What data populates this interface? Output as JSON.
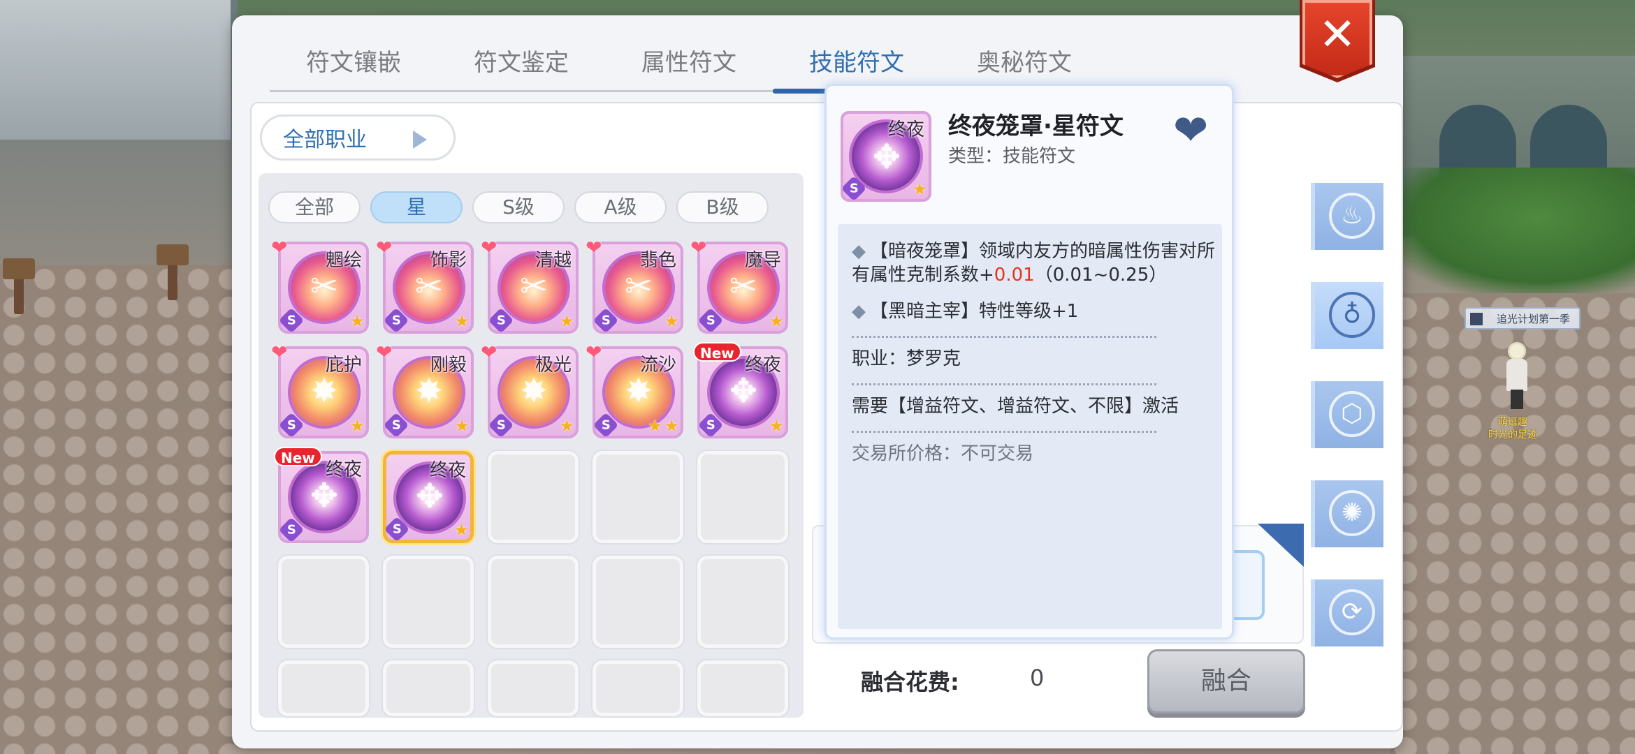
{
  "tabs": [
    {
      "label": "符文镶嵌"
    },
    {
      "label": "符文鉴定"
    },
    {
      "label": "属性符文"
    },
    {
      "label": "技能符文"
    },
    {
      "label": "奥秘符文"
    }
  ],
  "active_tab": "技能符文",
  "close_label": "✕",
  "job_filter": {
    "label": "全部职业"
  },
  "grade_filters": [
    {
      "label": "全部"
    },
    {
      "label": "星"
    },
    {
      "label": "S级"
    },
    {
      "label": "A级"
    },
    {
      "label": "B级"
    }
  ],
  "active_grade": "星",
  "runes": [
    {
      "name": "魍绘",
      "favorite": true,
      "grade": "S",
      "stars": 1,
      "new": false,
      "style": "pink"
    },
    {
      "name": "饰影",
      "favorite": true,
      "grade": "S",
      "stars": 1,
      "new": false,
      "style": "pink"
    },
    {
      "name": "清越",
      "favorite": true,
      "grade": "S",
      "stars": 1,
      "new": false,
      "style": "pink"
    },
    {
      "name": "翡色",
      "favorite": true,
      "grade": "S",
      "stars": 1,
      "new": false,
      "style": "pink"
    },
    {
      "name": "魔导",
      "favorite": true,
      "grade": "S",
      "stars": 1,
      "new": false,
      "style": "pink"
    },
    {
      "name": "庇护",
      "favorite": true,
      "grade": "S",
      "stars": 1,
      "new": false,
      "style": "gold"
    },
    {
      "name": "刚毅",
      "favorite": true,
      "grade": "S",
      "stars": 1,
      "new": false,
      "style": "gold"
    },
    {
      "name": "极光",
      "favorite": true,
      "grade": "S",
      "stars": 1,
      "new": false,
      "style": "gold"
    },
    {
      "name": "流沙",
      "favorite": true,
      "grade": "S",
      "stars": 2,
      "new": false,
      "style": "gold"
    },
    {
      "name": "终夜",
      "favorite": false,
      "grade": "S",
      "stars": 1,
      "new": true,
      "style": "dark"
    },
    {
      "name": "终夜",
      "favorite": false,
      "grade": "S",
      "stars": 0,
      "new": true,
      "style": "dark"
    },
    {
      "name": "终夜",
      "favorite": false,
      "grade": "S",
      "stars": 1,
      "new": false,
      "style": "dark",
      "selected": true
    }
  ],
  "new_badge": "New",
  "grade_badge": "S",
  "star_glyph": "★",
  "heart_glyph": "❤",
  "tooltip": {
    "icon_name": "终夜",
    "title": "终夜笼罩·星符文",
    "type": "类型：技能符文",
    "effect1_prefix": "【暗夜笼罩】领域内友方的暗属性伤害对所有属性克制系数+",
    "effect1_value": "0.01",
    "effect1_range": "（0.01~0.25）",
    "effect2": "【黑暗主宰】特性等级+1",
    "job": "职业：梦罗克",
    "requirement": "需要【增益符文、增益符文、不限】激活",
    "trade": "交易所价格：不可交易",
    "bullet": "◆"
  },
  "side_icons": [
    "flame-icon",
    "elements-icon",
    "shield-hex-icon",
    "swirl-icon",
    "recycle-icon"
  ],
  "fuse": {
    "cost_label": "融合花费:",
    "cost_value": "0",
    "button_label": "融合"
  },
  "scene": {
    "npc_sign": "追光计划第一季",
    "npc_name_line1": "萌逗趣",
    "npc_name_line2": "时光的足迹"
  },
  "colors": {
    "accent": "#2f6fb2",
    "close_red": "#d8351f",
    "highlight_red": "#e8331e",
    "selected_border": "#f2b53a"
  }
}
